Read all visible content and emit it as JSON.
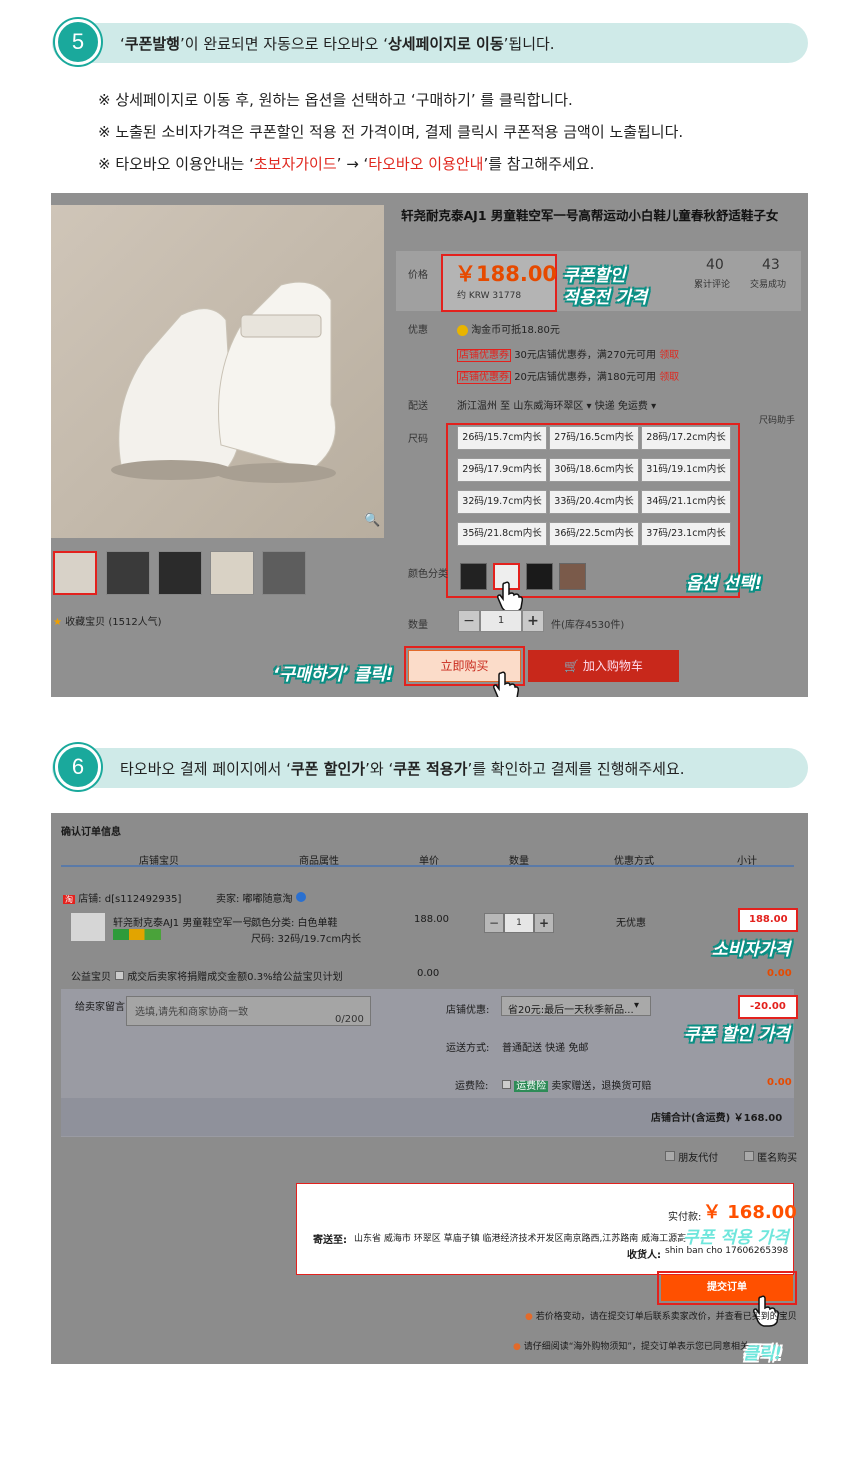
{
  "step5": {
    "num": "5",
    "text_pre": "‘",
    "text_b1": "쿠폰발행",
    "text_mid": "’이 완료되면 자동으로 타오바오 ‘",
    "text_b2": "상세페이지로 이동",
    "text_post": "’됩니다."
  },
  "notes": {
    "n1": "※ 상세페이지로 이동 후, 원하는 옵션을 선택하고 ‘구매하기’ 를 클릭합니다.",
    "n2": "※ 노출된 소비자가격은 쿠폰할인 적용 전 가격이며, 결제 클릭시 쿠폰적용 금액이 노출됩니다.",
    "n3_pre": "※ 타오바오 이용안내는 ‘",
    "n3_r1": "초보자가이드",
    "n3_mid": "’ → ‘",
    "n3_r2": "타오바오 이용안내",
    "n3_post": "’를 참고해주세요."
  },
  "product": {
    "title": "轩尧耐克泰AJ1 男童鞋空军一号高帮运动小白鞋儿童春秋舒适鞋子女",
    "price_label": "价格",
    "price": "￥188.00",
    "price_krw": "约 KRW 31778",
    "reviews_count": "40",
    "reviews_label": "累计评论",
    "sales_count": "43",
    "sales_label": "交易成功",
    "promo_label": "优惠",
    "coin_text": "淘金币可抵18.80元",
    "coupon_tag": "店铺优惠券",
    "coupon1": "30元店铺优惠券，满270元可用",
    "coupon2": "20元店铺优惠券，满180元可用",
    "coupon_get": "领取",
    "ship_label": "配送",
    "ship_text": "浙江温州 至  山东威海环翠区 ▾   快递 免运费 ▾",
    "size_help": "尺码助手",
    "size_label": "尺码",
    "sizes": [
      "26码/15.7cm内长",
      "27码/16.5cm内长",
      "28码/17.2cm内长",
      "29码/17.9cm内长",
      "30码/18.6cm内长",
      "31码/19.1cm内长",
      "32码/19.7cm内长",
      "33码/20.4cm内长",
      "34码/21.1cm内长",
      "35码/21.8cm内长",
      "36码/22.5cm内长",
      "37码/23.1cm内长"
    ],
    "color_label": "颜色分类",
    "qty_label": "数量",
    "qty": "1",
    "stock": "件(库存4530件)",
    "buy_now": "立即购买",
    "add_cart": "加入购物车",
    "favorite": "收藏宝贝 (1512人气)",
    "callout_price": "쿠폰할인\n적용전 가격",
    "callout_price1": "쿠폰할인",
    "callout_price2": "적용전 가격",
    "callout_option": "옵션 선택!",
    "callout_buy": "‘구매하기’ 클릭!"
  },
  "step6": {
    "num": "6",
    "text_pre": "타오바오 결제 페이지에서 ‘",
    "text_b1": "쿠폰 할인가",
    "text_mid": "’와 ‘",
    "text_b2": "쿠폰 적용가",
    "text_post": "’를 확인하고 결제를 진행해주세요."
  },
  "order": {
    "heading": "确认订单信息",
    "cols": [
      "店铺宝贝",
      "商品属性",
      "单价",
      "数量",
      "优惠方式",
      "小计"
    ],
    "shop": "店铺: d[s112492935]",
    "seller": "卖家: 嘟嘟随意淘",
    "item_name": "轩尧耐克泰AJ1 男童鞋空军一号...",
    "attr1": "颜色分类: 白色单鞋",
    "attr2": "尺码: 32码/19.7cm内长",
    "unit_price": "188.00",
    "qty": "1",
    "discount": "无优惠",
    "subtotal": "188.00",
    "charity_label": "公益宝贝",
    "charity_text": "成交后卖家将捐赠成交金额0.3%给公益宝贝计划",
    "charity_amt": "0.00",
    "charity_sub": "0.00",
    "msg_label": "给卖家留言:",
    "msg_placeholder": "选填,请先和商家协商一致",
    "msg_count": "0/200",
    "shop_coupon_label": "店铺优惠:",
    "shop_coupon_value": "省20元:最后一天秋季新品...",
    "coupon_amt": "-20.00",
    "ship_label": "运送方式:",
    "ship_value": "普通配送 快递 免邮",
    "insure_label": "运费险:",
    "insure_tag": "运费险",
    "insure_text": "卖家赠送，退换货可赔",
    "insure_amt": "0.00",
    "shop_total": "店铺合计(含运费)  ￥168.00",
    "friend_pay": "朋友代付",
    "anon": "匿名购买",
    "actual_label": "实付款:",
    "actual_amt": "￥ 168.00",
    "address_label": "寄送至:",
    "address": "山东省 威海市 环翠区 草庙子镇 临港经济技术开发区南京路西,江苏路南 威海工源高",
    "receiver_label": "收货人:",
    "receiver": "shin ban cho 17606265398",
    "submit": "提交订单",
    "tip1": "若价格变动，请在提交订单后联系卖家改价，并查看已买到的宝贝",
    "tip2": "请仔细阅读“海外购物须知”，提交订单表示您已同意相关",
    "callout_consumer": "소비자가격",
    "callout_discount": "쿠폰 할인 가격",
    "callout_applied": "쿠폰 적용 가격",
    "callout_click": "클릭!"
  },
  "icons": [
    "search-icon",
    "star-icon",
    "cart-icon",
    "hand-pointer-icon",
    "coin-icon",
    "info-icon"
  ],
  "colors": {
    "accent_teal": "#1aa99c",
    "step_bar": "#cfeae8",
    "highlight_red": "#e3211d",
    "taobao_orange": "#ff5000",
    "cart_red": "#c8281b"
  }
}
